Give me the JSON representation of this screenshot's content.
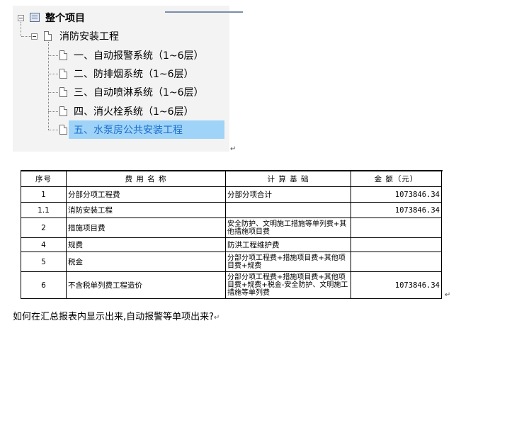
{
  "tree": {
    "root": "整个项目",
    "child": "消防安装工程",
    "items": [
      "一、自动报警系统（1~6层）",
      "二、防排烟系统（1~6层）",
      "三、自动喷淋系统（1~6层）",
      "四、消火栓系统（1~6层）",
      "五、水泵房公共安装工程"
    ]
  },
  "table": {
    "columns": [
      "序号",
      "费 用 名 称",
      "计 算 基 础",
      "金  额（元）"
    ],
    "rows": [
      {
        "no": "1",
        "name": "分部分项工程费",
        "basis": "分部分项合计",
        "amount": "1073846.34"
      },
      {
        "no": "1.1",
        "name": "消防安装工程",
        "basis": "",
        "amount": "1073846.34"
      },
      {
        "no": "2",
        "name": "措施项目费",
        "basis": "安全防护、文明施工措施等单列费+其他措施项目费",
        "amount": ""
      },
      {
        "no": "4",
        "name": "规费",
        "basis": "防洪工程维护费",
        "amount": ""
      },
      {
        "no": "5",
        "name": "税金",
        "basis": "分部分项工程费+措施项目费+其他项目费+规费",
        "amount": ""
      },
      {
        "no": "6",
        "name": "不含税单列费工程造价",
        "basis": "分部分项工程费+措施项目费+其他项目费+规费+税金-安全防护、文明施工措施等单列费",
        "amount": "1073846.34"
      }
    ]
  },
  "question": "如何在汇总报表内显示出来,自动报警等单项出来?",
  "return_mark": "↵"
}
